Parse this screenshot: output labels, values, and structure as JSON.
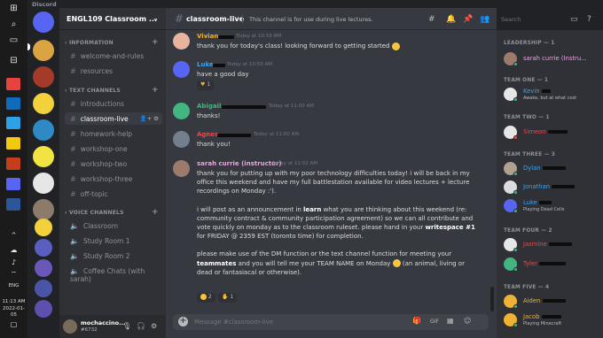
{
  "window": {
    "title": "Discord"
  },
  "taskbar": {
    "language": "ENG",
    "time": "11:13 AM",
    "date": "2022-01-05"
  },
  "guild": {
    "name": "ENGL109 Classroom ..."
  },
  "categories": {
    "information": "INFORMATION",
    "text": "TEXT CHANNELS",
    "voice": "VOICE CHANNELS"
  },
  "channels": {
    "information": [
      "welcome-and-rules",
      "resources"
    ],
    "text": [
      "introductions",
      "classroom-live",
      "homework-help",
      "workshop-one",
      "workshop-two",
      "workshop-three",
      "off-topic"
    ],
    "voice": [
      "Classroom",
      "Study Room 1",
      "Study Room 2",
      "Coffee Chats (with sarah)"
    ]
  },
  "user": {
    "name": "mochaccino...",
    "tag": "#6732"
  },
  "header": {
    "channel": "classroom-live",
    "topic": "This channel is for use during live lectures."
  },
  "search": {
    "placeholder": "Search"
  },
  "messages": [
    {
      "author": "Vivian",
      "author_color": "#f0b232",
      "time": "Today at 10:59 AM",
      "text": "thank you for today's class! looking forward to getting started"
    },
    {
      "author": "Luke",
      "author_color": "#3ba3f0",
      "time": "Today at 10:59 AM",
      "text": "have a good day",
      "reaction": "1"
    },
    {
      "author": "Abigail",
      "author_color": "#43b581",
      "time": "Today at 11:00 AM",
      "text": "thanks!"
    },
    {
      "author": "Agnes",
      "author_color": "#f04747",
      "time": "Today at 11:00 AM",
      "text": "thank you!"
    },
    {
      "author": "sarah currie (instructor)",
      "author_color": "#e9a5e0",
      "time": "Today at 11:02 AM",
      "p1": "thank you for putting up with my poor technology difficulties today! i will be back in my office this weekend and have my full battlestation available for video lectures + lecture recordings on Monday :').",
      "p2_a": "i will post as an announcement in ",
      "p2_b": "learn",
      "p2_c": " what you are thinking about this weekend (re: community contract & community participation agreement) so we can all contribute and vote quickly on monday as to the classroom ruleset. please hand in your ",
      "p2_d": "writespace #1",
      "p2_e": " for FRIDAY @ 2359 EST (toronto time) for completion.",
      "p3_a": "please make use of the DM function or the text channel function for meeting your ",
      "p3_b": "teammates",
      "p3_c": " and you will tell me your TEAM NAME on Monday ",
      "p3_d": " (an animal, living or dead or fantasiacal or otherwise).",
      "reactions": [
        "2",
        "1"
      ]
    }
  ],
  "composer": {
    "placeholder": "Message #classroom-live"
  },
  "roles": {
    "leadership": "LEADERSHIP — 1",
    "team1": "TEAM ONE — 1",
    "team2": "TEAM TWO — 1",
    "team3": "TEAM THREE — 3",
    "team4": "TEAM FOUR — 2",
    "team5": "TEAM FIVE — 4"
  },
  "members": {
    "sarah": {
      "name": "sarah currie (Instru...",
      "color": "#e9a5e0"
    },
    "kevin": {
      "name": "Kevin",
      "activity": "Awake, but at what cost",
      "color": "#3ba3f0"
    },
    "simeon": {
      "name": "Simeon",
      "color": "#f04747"
    },
    "dylan": {
      "name": "Dylan",
      "color": "#3ba3f0"
    },
    "jonathan": {
      "name": "Jonathan",
      "color": "#3ba3f0"
    },
    "luke": {
      "name": "Luke",
      "activity": "Playing Dead Cells",
      "color": "#3ba3f0"
    },
    "jasmine": {
      "name": "Jasmine",
      "color": "#f04747"
    },
    "tyler": {
      "name": "Tyler",
      "color": "#f04747"
    },
    "aiden": {
      "name": "Aiden",
      "color": "#f0b232"
    },
    "jacob": {
      "name": "Jacob",
      "activity": "Playing Minecraft",
      "color": "#f0b232"
    }
  },
  "colors": {
    "online": "#43b581",
    "dnd": "#f04747",
    "blurple": "#5865f2"
  }
}
